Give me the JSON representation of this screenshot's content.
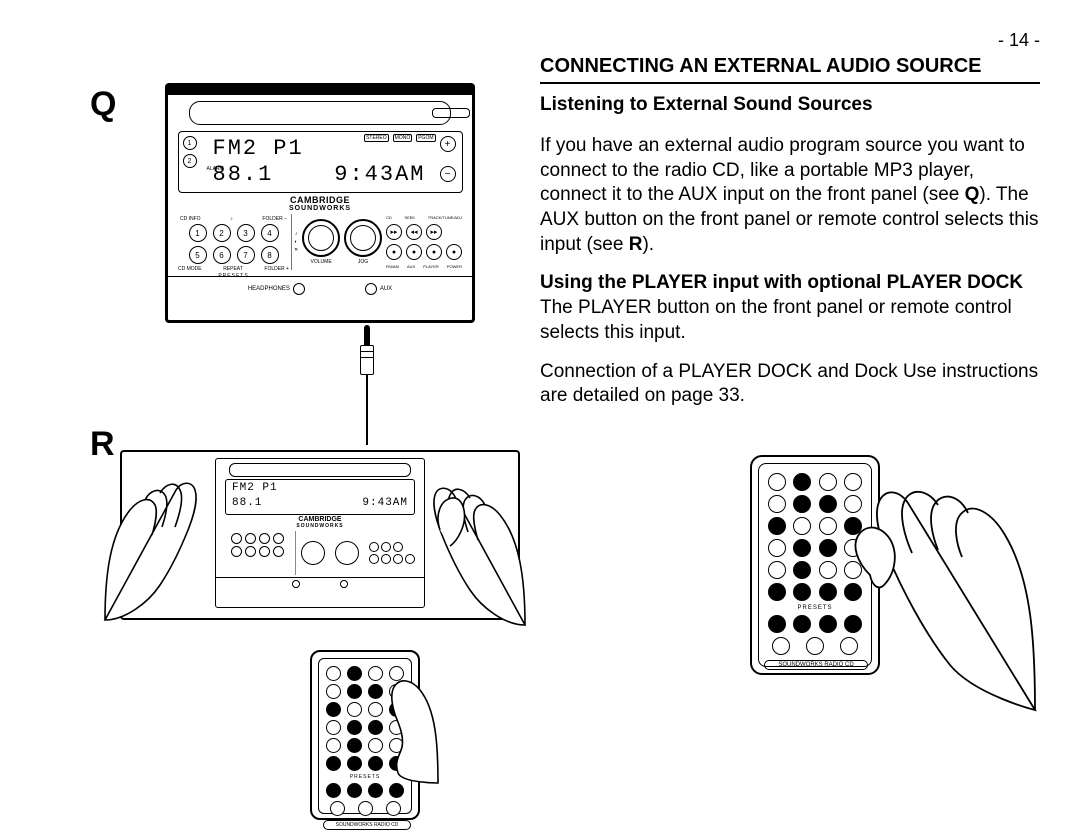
{
  "page_number": "- 14 -",
  "section_title": "CONNECTING AN EXTERNAL AUDIO SOURCE",
  "subhead1": "Listening to External Sound Sources",
  "para1_a": "If you have an external audio program source you want to connect to the radio CD, like a portable MP3 player, connect it to the AUX input on the front panel (see ",
  "para1_q": "Q",
  "para1_b": "). The AUX button on the front panel or remote control selects this input (see ",
  "para1_r": "R",
  "para1_c": ").",
  "subhead2": "Using the PLAYER input with optional PLAYER DOCK",
  "para2": "The PLAYER button on the front panel or remote control selects this input.",
  "para3": "Connection of a PLAYER DOCK and Dock Use instructions are detailed on page 33.",
  "labels": {
    "Q": "Q",
    "R": "R"
  },
  "device": {
    "brand_top": "CAMBRIDGE",
    "brand_sub": "SOUNDWORKS",
    "lcd_line1_left": "FM2 P1",
    "lcd_line2_left": "88.1",
    "lcd_line2_right": "9:43AM",
    "ind_1": "1",
    "ind_2": "2",
    "alarm": "ALARM",
    "plus": "+",
    "minus": "−",
    "tiny1": "STEREO",
    "tiny2": "MONO",
    "tiny3": "PGOM",
    "preset_top_l": "CD INFO",
    "preset_top_r": "FOLDER −",
    "preset_bot_l": "CD MODE",
    "preset_bot_m": "REPEAT",
    "preset_bot_r": "FOLDER +",
    "presets_label": "PRESETS",
    "p1": "1",
    "p2": "2",
    "p3": "3",
    "p4": "4",
    "p5": "5",
    "p6": "6",
    "p7": "7",
    "p8": "8",
    "vol_label": "VOLUME",
    "jog_label": "JOG",
    "trans_top_l": "CD",
    "trans_top_m": "SEEK",
    "trans_top_r": "TRACK/TUNE/ADJ",
    "trans_bot_1": "FM/AM",
    "trans_bot_2": "AUX",
    "trans_bot_3": "PLAYER",
    "trans_bot_4": "POWER",
    "jack_hp": "HEADPHONES",
    "jack_aux": "AUX"
  },
  "remote": {
    "presets_label": "PRESETS",
    "footer": "SOUNDWORKS RADIO CD"
  }
}
